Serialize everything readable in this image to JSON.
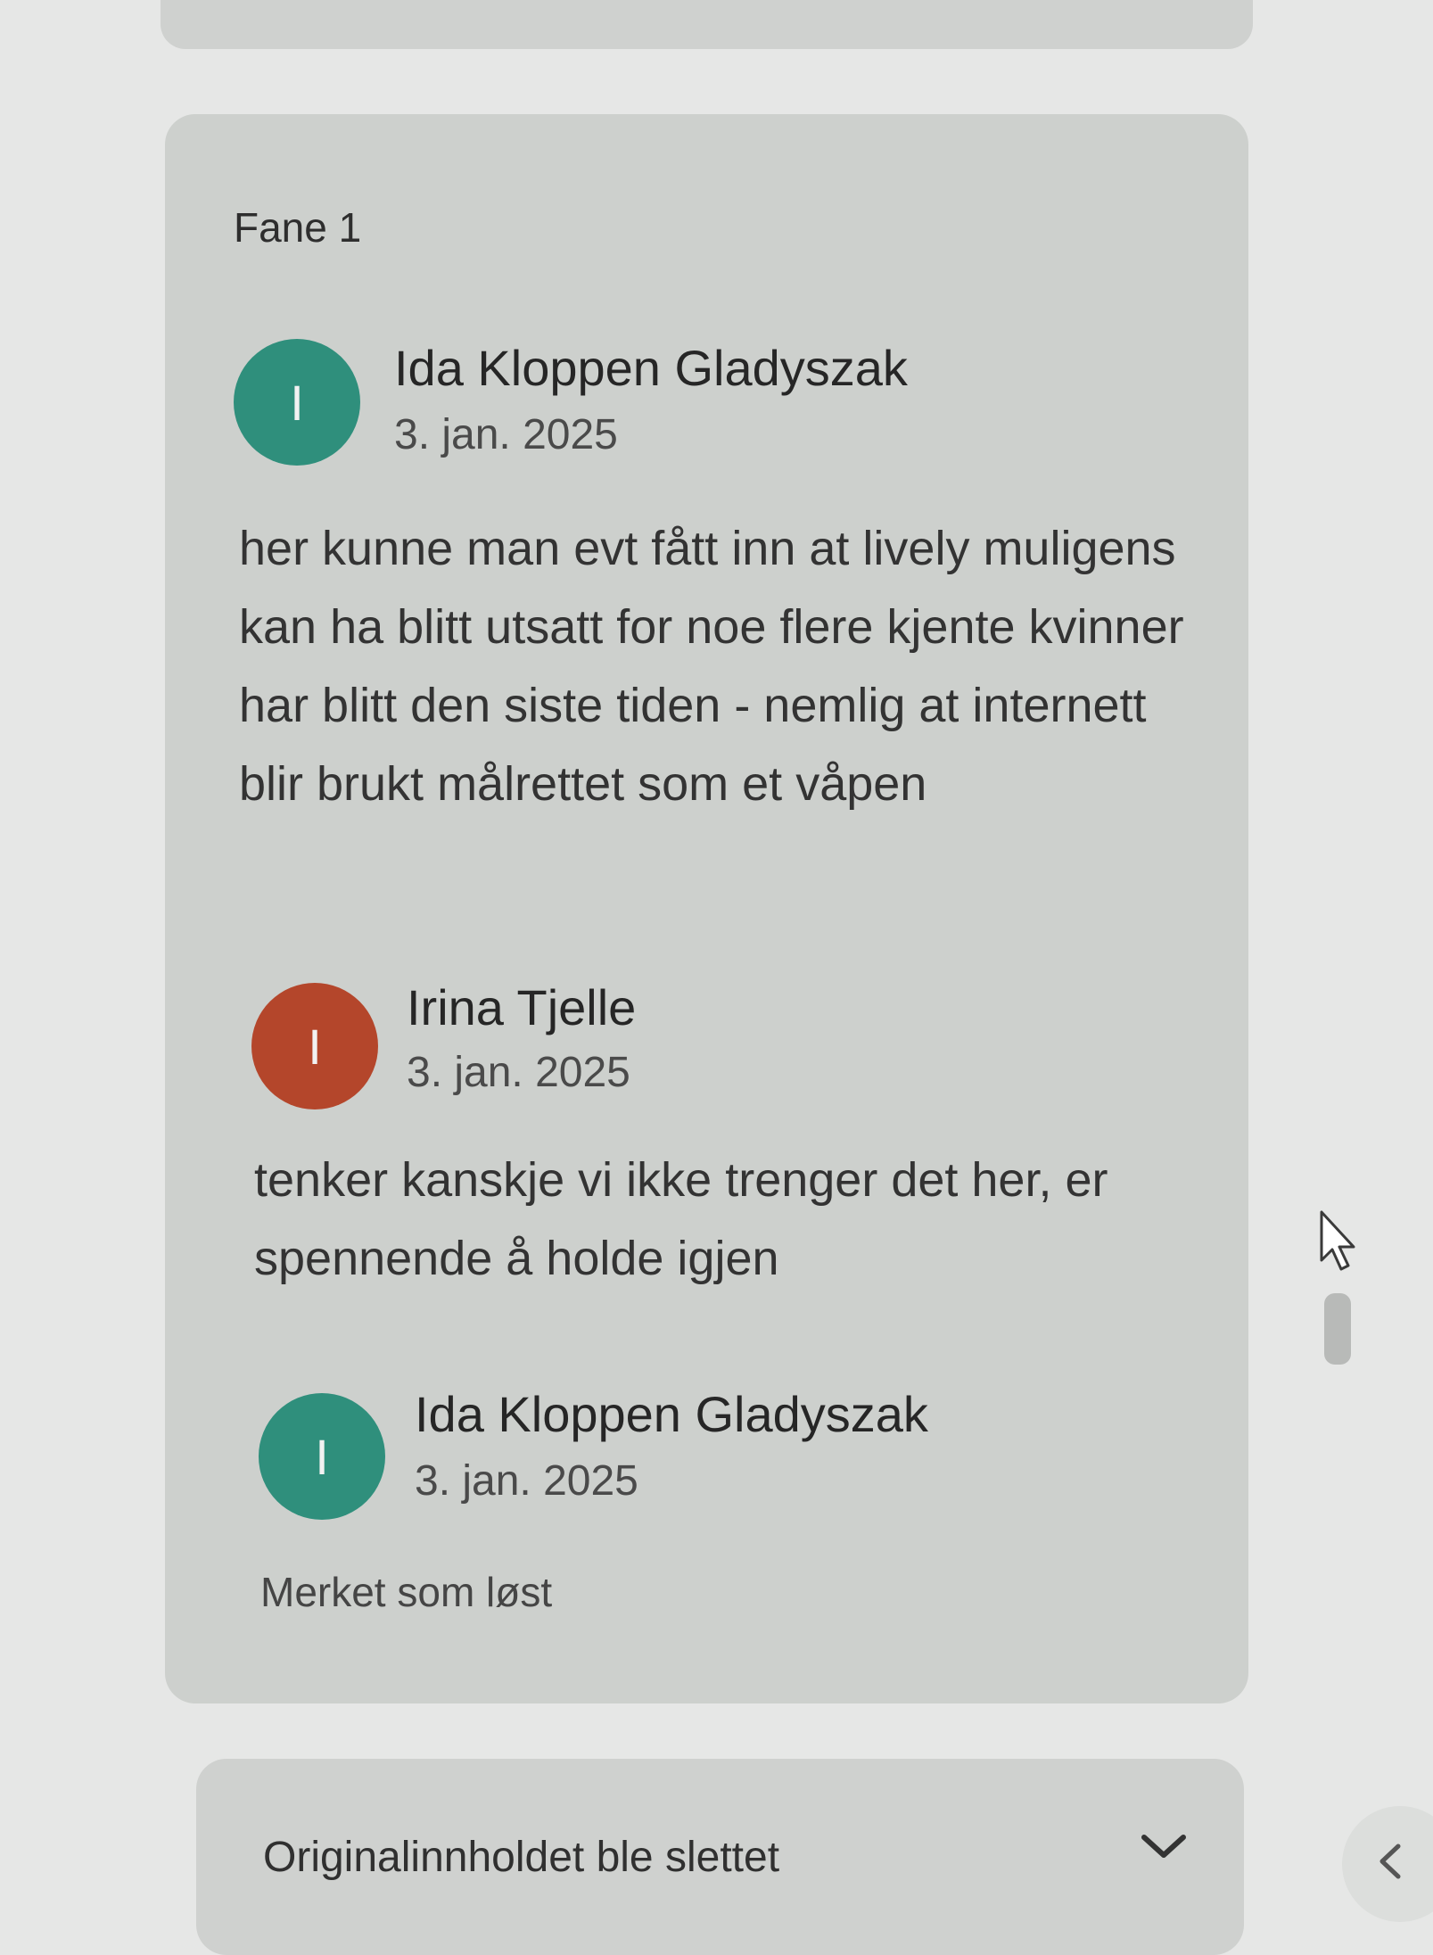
{
  "tab": {
    "label": "Fane 1"
  },
  "comments": [
    {
      "author": "Ida Kloppen Gladyszak",
      "date": "3. jan. 2025",
      "initial": "I",
      "avatar_color": "#2f8f7c",
      "text": "her kunne man evt fått inn at lively muligens kan ha blitt utsatt for noe flere kjente kvinner har blitt den siste tiden - nemlig at internett blir brukt målrettet som et våpen"
    },
    {
      "author": "Irina Tjelle",
      "date": "3. jan. 2025",
      "initial": "I",
      "avatar_color": "#b4462b",
      "text": "tenker kanskje vi ikke trenger det her, er spennende å holde igjen"
    },
    {
      "author": "Ida Kloppen Gladyszak",
      "date": "3. jan. 2025",
      "initial": "I",
      "avatar_color": "#2f8f7c",
      "status": "Merket som løst"
    }
  ],
  "next_thread": {
    "label": "Originalinnholdet ble slettet",
    "icon": "chevron-down-icon"
  }
}
